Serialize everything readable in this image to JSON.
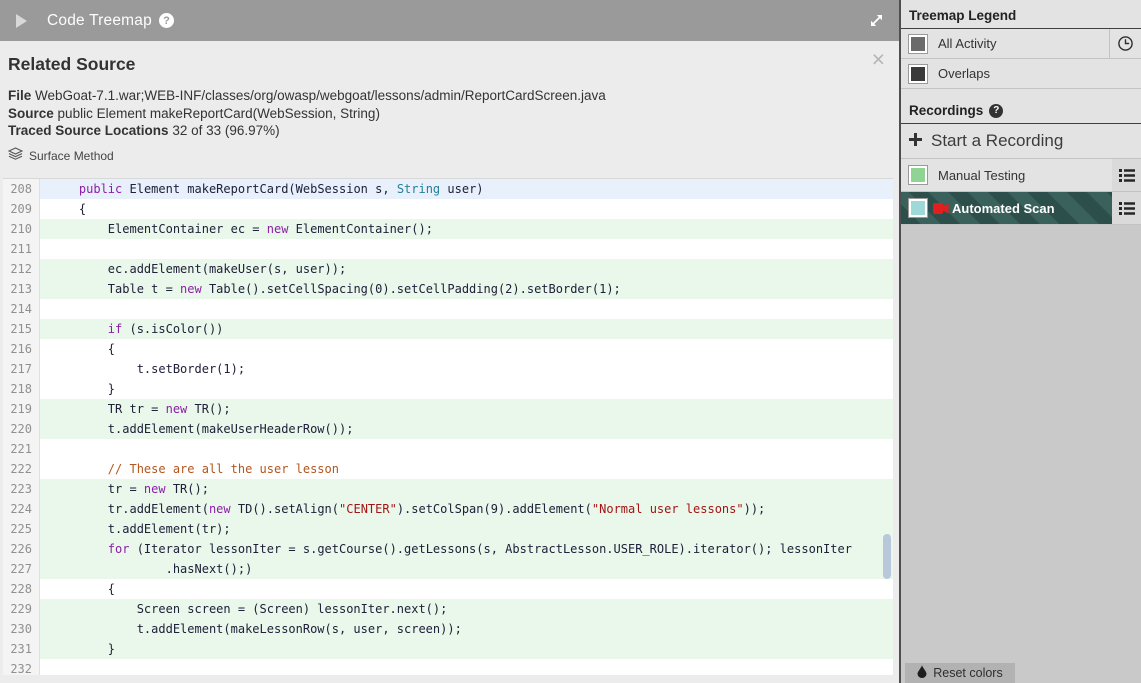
{
  "icons": {
    "help": "?",
    "close": "×"
  },
  "header": {
    "title": "Code Treemap"
  },
  "panel": {
    "title": "Related Source",
    "file_label": "File",
    "file_value": "WebGoat-7.1.war;WEB-INF/classes/org/owasp/webgoat/lessons/admin/ReportCardScreen.java",
    "source_label": "Source",
    "source_value": "public Element makeReportCard(WebSession, String)",
    "traced_label": "Traced Source Locations",
    "traced_value": "32 of 33 (96.97%)",
    "surface_method": "Surface Method"
  },
  "code": {
    "lines": [
      {
        "n": 208,
        "bg": "b",
        "s": [
          [
            "    ",
            ""
          ],
          [
            "public",
            "k"
          ],
          [
            " Element makeReportCard(WebSession s, ",
            ""
          ],
          [
            "String",
            "t"
          ],
          [
            " user)",
            ""
          ]
        ]
      },
      {
        "n": 209,
        "bg": "w",
        "s": [
          [
            "    {",
            ""
          ]
        ]
      },
      {
        "n": 210,
        "bg": "g",
        "s": [
          [
            "        ElementContainer ec = ",
            ""
          ],
          [
            "new",
            "k"
          ],
          [
            " ElementContainer();",
            ""
          ]
        ]
      },
      {
        "n": 211,
        "bg": "w",
        "s": [
          [
            "",
            ""
          ]
        ]
      },
      {
        "n": 212,
        "bg": "g",
        "s": [
          [
            "        ec.addElement(makeUser(s, user));",
            ""
          ]
        ]
      },
      {
        "n": 213,
        "bg": "g",
        "s": [
          [
            "        Table t = ",
            ""
          ],
          [
            "new",
            "k"
          ],
          [
            " Table().setCellSpacing(0).setCellPadding(2).setBorder(1);",
            ""
          ]
        ]
      },
      {
        "n": 214,
        "bg": "w",
        "s": [
          [
            "",
            ""
          ]
        ]
      },
      {
        "n": 215,
        "bg": "g",
        "s": [
          [
            "        ",
            ""
          ],
          [
            "if",
            "k"
          ],
          [
            " (s.isColor())",
            ""
          ]
        ]
      },
      {
        "n": 216,
        "bg": "w",
        "s": [
          [
            "        {",
            ""
          ]
        ]
      },
      {
        "n": 217,
        "bg": "w",
        "s": [
          [
            "            t.setBorder(1);",
            ""
          ]
        ]
      },
      {
        "n": 218,
        "bg": "w",
        "s": [
          [
            "        }",
            ""
          ]
        ]
      },
      {
        "n": 219,
        "bg": "g",
        "s": [
          [
            "        TR tr = ",
            ""
          ],
          [
            "new",
            "k"
          ],
          [
            " TR();",
            ""
          ]
        ]
      },
      {
        "n": 220,
        "bg": "g",
        "s": [
          [
            "        t.addElement(makeUserHeaderRow());",
            ""
          ]
        ]
      },
      {
        "n": 221,
        "bg": "w",
        "s": [
          [
            "",
            ""
          ]
        ]
      },
      {
        "n": 222,
        "bg": "w",
        "s": [
          [
            "        ",
            ""
          ],
          [
            "// These are all the user lesson",
            "c"
          ]
        ]
      },
      {
        "n": 223,
        "bg": "g",
        "s": [
          [
            "        tr = ",
            ""
          ],
          [
            "new",
            "k"
          ],
          [
            " TR();",
            ""
          ]
        ]
      },
      {
        "n": 224,
        "bg": "g",
        "s": [
          [
            "        tr.addElement(",
            ""
          ],
          [
            "new",
            "k"
          ],
          [
            " TD().setAlign(",
            ""
          ],
          [
            "\"CENTER\"",
            "s"
          ],
          [
            ").setColSpan(9).addElement(",
            ""
          ],
          [
            "\"Normal user lessons\"",
            "s"
          ],
          [
            "));",
            ""
          ]
        ]
      },
      {
        "n": 225,
        "bg": "g",
        "s": [
          [
            "        t.addElement(tr);",
            ""
          ]
        ]
      },
      {
        "n": 226,
        "bg": "g",
        "s": [
          [
            "        ",
            ""
          ],
          [
            "for",
            "k"
          ],
          [
            " (Iterator lessonIter = s.getCourse().getLessons(s, AbstractLesson.USER_ROLE).iterator(); lessonIter",
            ""
          ]
        ]
      },
      {
        "n": 227,
        "bg": "g",
        "s": [
          [
            "                .hasNext();)",
            ""
          ]
        ]
      },
      {
        "n": 228,
        "bg": "w",
        "s": [
          [
            "        {",
            ""
          ]
        ]
      },
      {
        "n": 229,
        "bg": "g",
        "s": [
          [
            "            Screen screen = (Screen) lessonIter.next();",
            ""
          ]
        ]
      },
      {
        "n": 230,
        "bg": "g",
        "s": [
          [
            "            t.addElement(makeLessonRow(s, user, screen));",
            ""
          ]
        ]
      },
      {
        "n": 231,
        "bg": "g",
        "s": [
          [
            "        }",
            ""
          ]
        ]
      },
      {
        "n": 232,
        "bg": "w",
        "s": [
          [
            "",
            ""
          ]
        ]
      }
    ]
  },
  "sidebar": {
    "legend_title": "Treemap Legend",
    "legend_items": [
      {
        "label": "All Activity",
        "color": "#6b6b6b"
      },
      {
        "label": "Overlaps",
        "color": "#3a3a3a"
      }
    ],
    "recordings_title": "Recordings",
    "start_recording": "Start a Recording",
    "recordings": [
      {
        "label": "Manual Testing",
        "color": "#8fd492",
        "selected": false
      },
      {
        "label": "Automated Scan",
        "color": "#9fd9d7",
        "selected": true
      }
    ],
    "reset_colors": "Reset colors"
  },
  "colors": {
    "header_bg": "#9a9a9a",
    "panel_bg": "#ececec",
    "row_highlight_blue": "#e7f0fb",
    "row_highlight_green": "#e9f8ea",
    "keyword": "#8b1fa8",
    "string": "#a31515",
    "comment": "#b3551e",
    "type": "#267f99",
    "selected_stripe_dark": "#2d4f4b",
    "selected_stripe_light": "#3a615c"
  }
}
